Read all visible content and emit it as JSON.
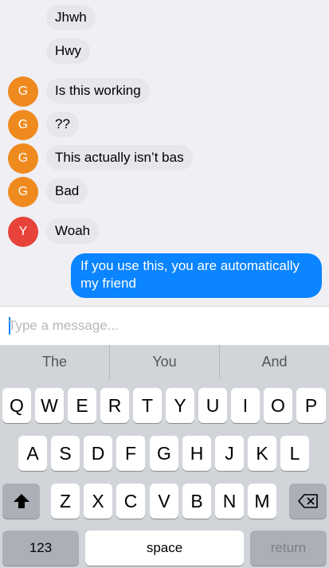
{
  "messages": [
    {
      "text": "Jhwh",
      "avatar": ""
    },
    {
      "text": "Hwy",
      "avatar": ""
    },
    {
      "text": "Is this working",
      "avatar": "G",
      "color": "#ef8a1f"
    },
    {
      "text": "??",
      "avatar": "G",
      "color": "#ef8a1f"
    },
    {
      "text": "This actually isn’t bas",
      "avatar": "G",
      "color": "#ef8a1f"
    },
    {
      "text": "Bad",
      "avatar": "G",
      "color": "#ef8a1f"
    },
    {
      "text": "Woah",
      "avatar": "Y",
      "color": "#e8433b"
    }
  ],
  "outgoing": {
    "text": "If you use this, you are automatically my friend"
  },
  "composer": {
    "placeholder": "Type a message..."
  },
  "suggestions": [
    "The",
    "You",
    "And"
  ],
  "keyboard": {
    "row1": [
      "Q",
      "W",
      "E",
      "R",
      "T",
      "Y",
      "U",
      "I",
      "O",
      "P"
    ],
    "row2": [
      "A",
      "S",
      "D",
      "F",
      "G",
      "H",
      "J",
      "K",
      "L"
    ],
    "row3": [
      "Z",
      "X",
      "C",
      "V",
      "B",
      "N",
      "M"
    ],
    "numbers_label": "123",
    "space_label": "space",
    "return_label": "return"
  },
  "colors": {
    "accent": "#0a84ff",
    "avatar_g": "#ef8a1f",
    "avatar_y": "#e8433b"
  }
}
